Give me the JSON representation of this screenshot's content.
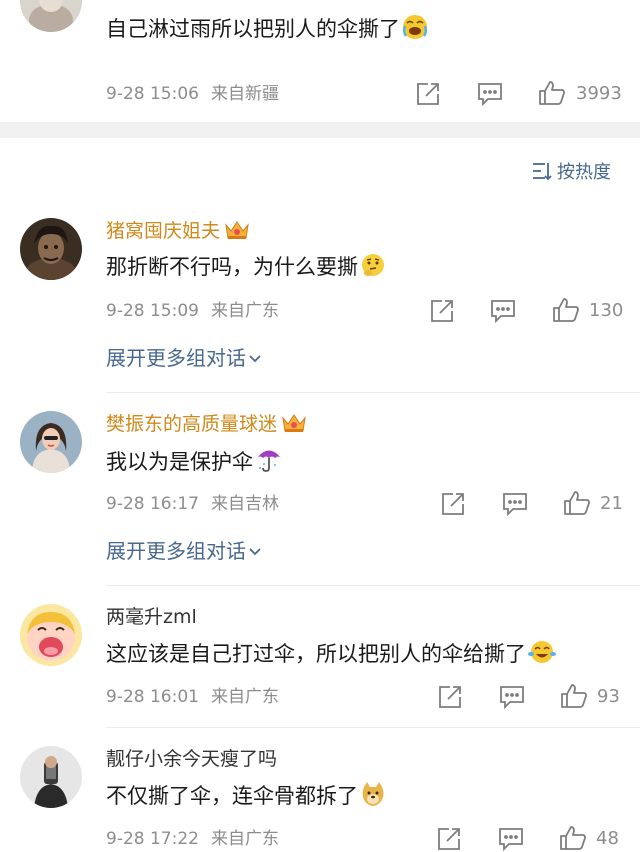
{
  "top_comment": {
    "text": "自己淋过雨所以把别人的伞撕了",
    "emoji": "crying-laughing-emoji",
    "time": "9-28 15:06",
    "source": "来自新疆",
    "likes": "3993"
  },
  "sort": {
    "label": "按热度",
    "icon": "sort-icon"
  },
  "comments": [
    {
      "username": "猪窝囤庆姐夫",
      "vip": true,
      "text": "那折断不行吗，为什么要撕",
      "emoji": "thinking-emoji",
      "time": "9-28 15:09",
      "source": "来自广东",
      "likes": "130",
      "expand_label": "展开更多组对话"
    },
    {
      "username": "樊振东的高质量球迷",
      "vip": true,
      "text": "我以为是保护伞",
      "emoji": "umbrella-emoji",
      "time": "9-28 16:17",
      "source": "来自吉林",
      "likes": "21",
      "expand_label": "展开更多组对话"
    },
    {
      "username": "两毫升zml",
      "vip": false,
      "text": "这应该是自己打过伞，所以把别人的伞给撕了",
      "emoji": "laughing-tears-emoji",
      "time": "9-28 16:01",
      "source": "来自广东",
      "likes": "93"
    },
    {
      "username": "靓仔小余今天瘦了吗",
      "vip": false,
      "text": "不仅撕了伞，连伞骨都拆了",
      "emoji": "doge-emoji",
      "time": "9-28 17:22",
      "source": "来自广东",
      "likes": "48"
    }
  ],
  "colors": {
    "vip_name": "#d08a1b",
    "link": "#48698f",
    "meta": "#8d8d8d",
    "text": "#1a1a1a"
  }
}
